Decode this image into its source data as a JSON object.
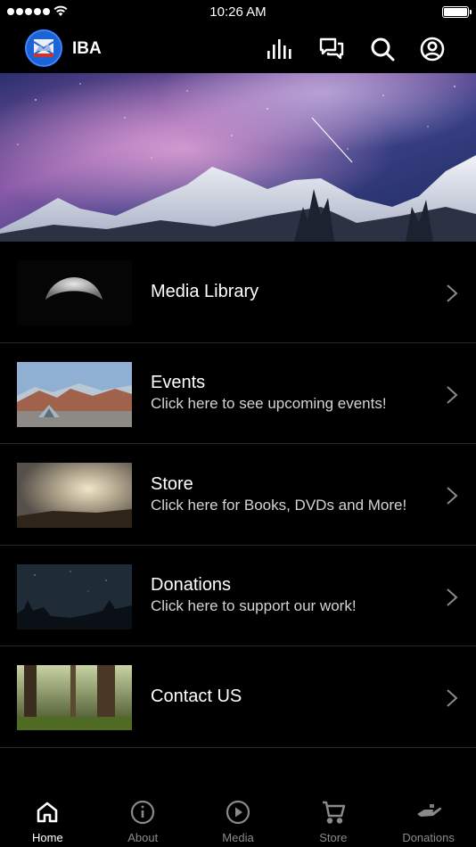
{
  "status_bar": {
    "time": "10:26 AM",
    "battery_level": 1.0,
    "signal_bars": 5
  },
  "header": {
    "title": "IBA",
    "actions": [
      {
        "icon": "bar-chart-icon"
      },
      {
        "icon": "chat-icon"
      },
      {
        "icon": "search-icon"
      },
      {
        "icon": "account-icon"
      }
    ]
  },
  "menu": {
    "items": [
      {
        "title": "Media Library",
        "subtitle": "",
        "thumbnail": "moon"
      },
      {
        "title": "Events",
        "subtitle": "Click here to see upcoming events!",
        "thumbnail": "tent-in-desert"
      },
      {
        "title": "Store",
        "subtitle": "Click here for Books, DVDs and More!",
        "thumbnail": "sunset-sky"
      },
      {
        "title": "Donations",
        "subtitle": "Click here to support our work!",
        "thumbnail": "night-forest"
      },
      {
        "title": "Contact US",
        "subtitle": "",
        "thumbnail": "green-forest"
      }
    ]
  },
  "tabs": [
    {
      "label": "Home",
      "icon": "home-icon",
      "active": true
    },
    {
      "label": "About",
      "icon": "info-icon",
      "active": false
    },
    {
      "label": "Media",
      "icon": "play-icon",
      "active": false
    },
    {
      "label": "Store",
      "icon": "cart-icon",
      "active": false
    },
    {
      "label": "Donations",
      "icon": "donate-hand-icon",
      "active": false
    }
  ],
  "colors": {
    "background": "#000000",
    "text": "#ffffff",
    "subtext": "#d4d4d4",
    "inactive_tab": "#8a8a8a",
    "divider": "#2a2a2a",
    "logo_blue": "#1e63d6"
  }
}
